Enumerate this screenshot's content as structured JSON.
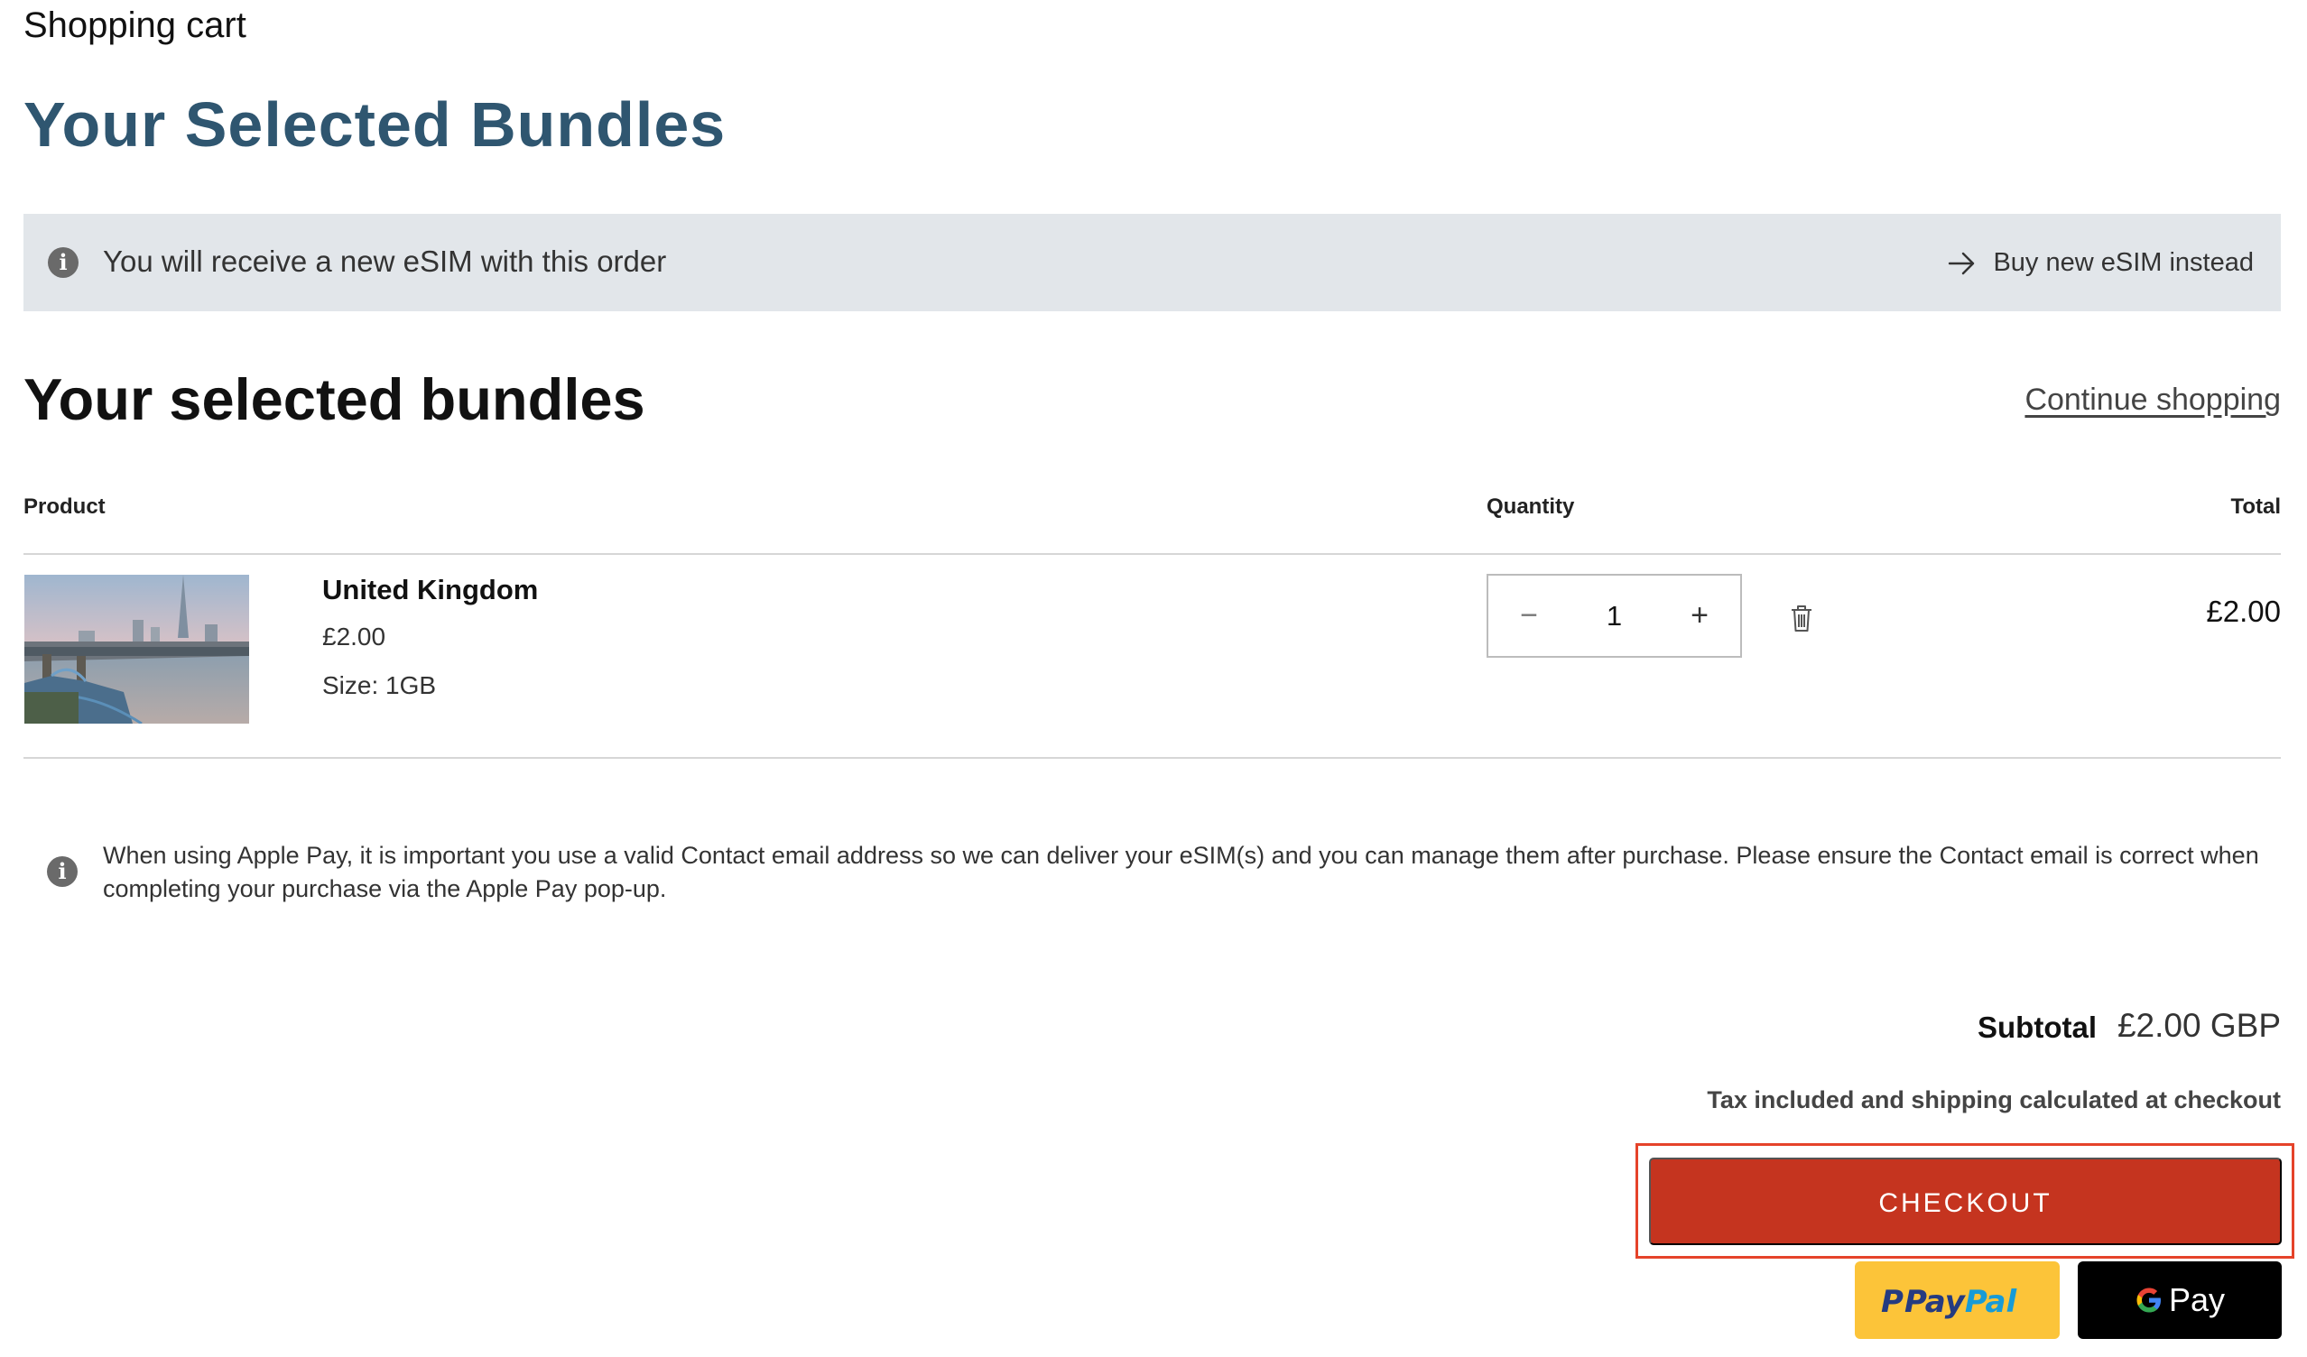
{
  "breadcrumb": "Shopping cart",
  "page_title": "Your Selected Bundles",
  "notice": {
    "text": "You will receive a new eSIM with this order",
    "link_label": "Buy new eSIM instead"
  },
  "cart": {
    "heading": "Your selected bundles",
    "continue_label": "Continue shopping",
    "columns": {
      "product": "Product",
      "quantity": "Quantity",
      "total": "Total"
    },
    "items": [
      {
        "name": "United Kingdom",
        "price": "£2.00",
        "size": "Size: 1GB",
        "quantity": "1",
        "total": "£2.00",
        "image_icon": "london-skyline-photo"
      }
    ],
    "qty_minus": "−",
    "qty_plus": "+"
  },
  "apple_pay_note": "When using Apple Pay, it is important you use a valid Contact email address so we can deliver your eSIM(s) and you can manage them after purchase. Please ensure the Contact email is correct when completing your purchase via the Apple Pay pop-up.",
  "summary": {
    "subtotal_label": "Subtotal",
    "subtotal_value": "£2.00 GBP",
    "tax_note": "Tax included and shipping calculated at checkout"
  },
  "buttons": {
    "checkout": "CHECKOUT",
    "paypal_text": "PayPal",
    "gpay_text": "Pay"
  },
  "colors": {
    "title": "#2f5670",
    "checkout_bg": "#c5341f",
    "highlight_border": "#e5432a",
    "paypal_bg": "#fcc439",
    "gpay_bg": "#000000",
    "notice_bg": "#e2e6ea"
  }
}
